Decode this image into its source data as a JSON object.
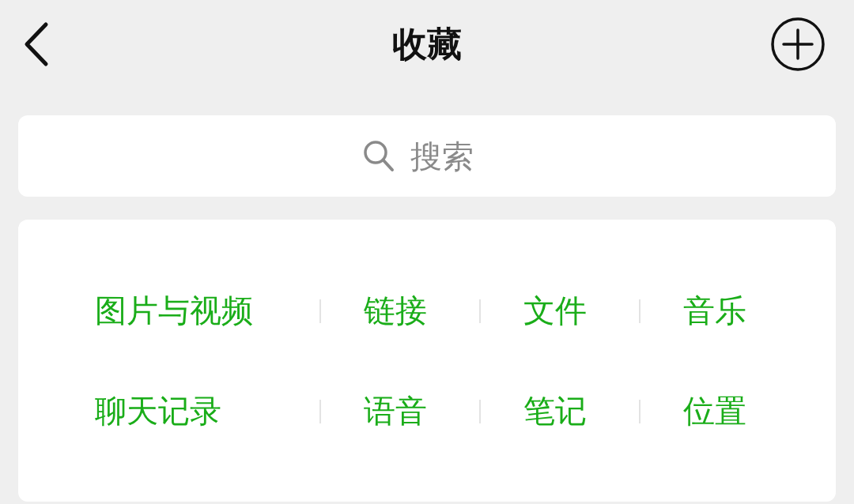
{
  "header": {
    "title": "收藏"
  },
  "search": {
    "placeholder": "搜索"
  },
  "categories": [
    {
      "label": "图片与视频"
    },
    {
      "label": "链接"
    },
    {
      "label": "文件"
    },
    {
      "label": "音乐"
    },
    {
      "label": "聊天记录"
    },
    {
      "label": "语音"
    },
    {
      "label": "笔记"
    },
    {
      "label": "位置"
    }
  ]
}
